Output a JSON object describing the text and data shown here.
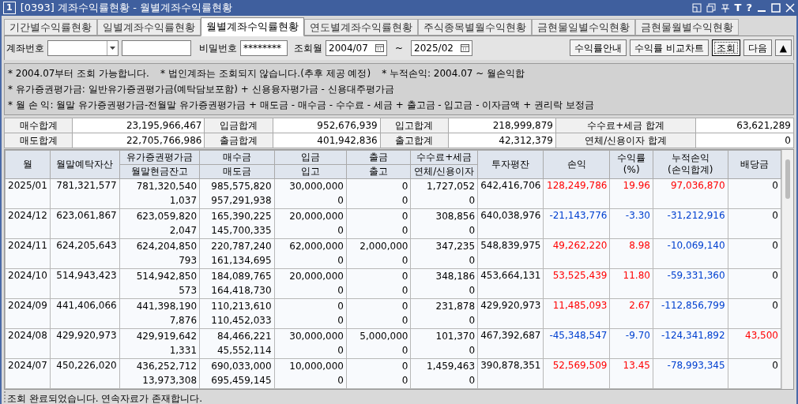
{
  "window": {
    "badge": "1",
    "title": "[0393] 계좌수익률현황 - 월별계좌수익률현황",
    "glyphs": [
      "T",
      "?"
    ]
  },
  "tabs": [
    {
      "label": "기간별수익률현황",
      "selected": false
    },
    {
      "label": "일별계좌수익률현황",
      "selected": false
    },
    {
      "label": "월별계좌수익률현황",
      "selected": true
    },
    {
      "label": "연도별계좌수익률현황",
      "selected": false
    },
    {
      "label": "주식종목별월수익현황",
      "selected": false
    },
    {
      "label": "금현물일별수익현황",
      "selected": false
    },
    {
      "label": "금현물월별수익현황",
      "selected": false
    }
  ],
  "form": {
    "account_label": "계좌번호",
    "password_label": "비밀번호",
    "password": "********",
    "period_label": "조회월",
    "from": "2004/07",
    "tilde": "~",
    "to": "2025/02"
  },
  "buttons": [
    {
      "label": "수익률안내",
      "focused": false
    },
    {
      "label": "수익률 비교차트",
      "focused": false
    },
    {
      "label": "조회",
      "focused": true
    },
    {
      "label": "다음",
      "focused": false
    },
    {
      "label": "▲",
      "focused": false
    }
  ],
  "notes": [
    [
      "* 2004.07부터 조회 가능합니다.",
      "* 법인계좌는 조회되지 않습니다.(추후 제공 예정)",
      "* 누적손익: 2004.07 ~ 월손익합"
    ],
    [
      "* 유가증권평가금: 일반유가증권평가금(예탁담보포함) + 신용융자평가금 - 신용대주평가금"
    ],
    [
      "* 월 손 익: 월말 유가증권평가금-전월말 유가증권평가금 + 매도금 - 매수금 - 수수료 - 세금 + 출고금 - 입고금 - 이자금액 + 권리락 보정금"
    ]
  ],
  "summary": [
    [
      {
        "label": "매수합계",
        "value": "23,195,966,467"
      },
      {
        "label": "입금합계",
        "value": "952,676,939"
      },
      {
        "label": "입고합계",
        "value": "218,999,879"
      },
      {
        "label": "수수료+세금 합계",
        "value": "63,621,289"
      }
    ],
    [
      {
        "label": "매도합계",
        "value": "22,705,766,986"
      },
      {
        "label": "출금합계",
        "value": "401,942,836"
      },
      {
        "label": "출고합계",
        "value": "42,312,379"
      },
      {
        "label": "연체/신용이자 합계",
        "value": "0"
      }
    ]
  ],
  "table": {
    "columns": [
      {
        "kind": "single",
        "lines": [
          "월"
        ]
      },
      {
        "kind": "single",
        "lines": [
          "월말예탁자산"
        ]
      },
      {
        "kind": "split",
        "top": "유가증권평가금",
        "bottom": "월말현금잔고"
      },
      {
        "kind": "split",
        "top": "매수금",
        "bottom": "매도금"
      },
      {
        "kind": "split",
        "top": "입금",
        "bottom": "입고"
      },
      {
        "kind": "split",
        "top": "출금",
        "bottom": "출고"
      },
      {
        "kind": "split",
        "top": "수수료+세금",
        "bottom": "연체/신용이자"
      },
      {
        "kind": "single",
        "lines": [
          "투자평잔"
        ]
      },
      {
        "kind": "single",
        "lines": [
          "손익"
        ]
      },
      {
        "kind": "single",
        "lines": [
          "수익률",
          "(%)"
        ]
      },
      {
        "kind": "single",
        "lines": [
          "누적손익",
          "(손익합계)"
        ]
      },
      {
        "kind": "single",
        "lines": [
          "배당금"
        ]
      }
    ],
    "rows": [
      {
        "month": "2025/01",
        "assets": "781,321,577",
        "sec": [
          "781,320,540",
          "1,037"
        ],
        "buy": [
          "985,575,820",
          "957,291,938"
        ],
        "dep": [
          "30,000,000",
          "0"
        ],
        "wd": [
          "0",
          "0"
        ],
        "fee": [
          "1,727,052",
          "0"
        ],
        "avg": "642,416,706",
        "pnl": {
          "value": "128,249,786",
          "color": "#ff0000"
        },
        "rate": {
          "value": "19.96",
          "color": "#ff0000"
        },
        "cum": {
          "value": "97,036,870",
          "color": "#ff0000"
        },
        "div": {
          "value": "0",
          "color": "#000000"
        }
      },
      {
        "month": "2024/12",
        "assets": "623,061,867",
        "sec": [
          "623,059,820",
          "2,047"
        ],
        "buy": [
          "165,390,225",
          "145,700,335"
        ],
        "dep": [
          "20,000,000",
          "0"
        ],
        "wd": [
          "0",
          "0"
        ],
        "fee": [
          "308,856",
          "0"
        ],
        "avg": "640,038,976",
        "pnl": {
          "value": "-21,143,776",
          "color": "#0040d0"
        },
        "rate": {
          "value": "-3.30",
          "color": "#0040d0"
        },
        "cum": {
          "value": "-31,212,916",
          "color": "#0040d0"
        },
        "div": {
          "value": "0",
          "color": "#000000"
        }
      },
      {
        "month": "2024/11",
        "assets": "624,205,643",
        "sec": [
          "624,204,850",
          "793"
        ],
        "buy": [
          "220,787,240",
          "161,134,695"
        ],
        "dep": [
          "62,000,000",
          "0"
        ],
        "wd": [
          "2,000,000",
          "0"
        ],
        "fee": [
          "347,235",
          "0"
        ],
        "avg": "548,839,975",
        "pnl": {
          "value": "49,262,220",
          "color": "#ff0000"
        },
        "rate": {
          "value": "8.98",
          "color": "#ff0000"
        },
        "cum": {
          "value": "-10,069,140",
          "color": "#0040d0"
        },
        "div": {
          "value": "0",
          "color": "#000000"
        }
      },
      {
        "month": "2024/10",
        "assets": "514,943,423",
        "sec": [
          "514,942,850",
          "573"
        ],
        "buy": [
          "184,089,765",
          "164,418,730"
        ],
        "dep": [
          "20,000,000",
          "0"
        ],
        "wd": [
          "0",
          "0"
        ],
        "fee": [
          "348,186",
          "0"
        ],
        "avg": "453,664,131",
        "pnl": {
          "value": "53,525,439",
          "color": "#ff0000"
        },
        "rate": {
          "value": "11.80",
          "color": "#ff0000"
        },
        "cum": {
          "value": "-59,331,360",
          "color": "#0040d0"
        },
        "div": {
          "value": "0",
          "color": "#000000"
        }
      },
      {
        "month": "2024/09",
        "assets": "441,406,066",
        "sec": [
          "441,398,190",
          "7,876"
        ],
        "buy": [
          "110,213,610",
          "110,452,033"
        ],
        "dep": [
          "0",
          "0"
        ],
        "wd": [
          "0",
          "0"
        ],
        "fee": [
          "231,878",
          "0"
        ],
        "avg": "429,920,973",
        "pnl": {
          "value": "11,485,093",
          "color": "#ff0000"
        },
        "rate": {
          "value": "2.67",
          "color": "#ff0000"
        },
        "cum": {
          "value": "-112,856,799",
          "color": "#0040d0"
        },
        "div": {
          "value": "0",
          "color": "#000000"
        }
      },
      {
        "month": "2024/08",
        "assets": "429,920,973",
        "sec": [
          "429,919,642",
          "1,331"
        ],
        "buy": [
          "84,466,221",
          "45,552,114"
        ],
        "dep": [
          "30,000,000",
          "0"
        ],
        "wd": [
          "5,000,000",
          "0"
        ],
        "fee": [
          "101,370",
          "0"
        ],
        "avg": "467,392,687",
        "pnl": {
          "value": "-45,348,547",
          "color": "#0040d0"
        },
        "rate": {
          "value": "-9.70",
          "color": "#0040d0"
        },
        "cum": {
          "value": "-124,341,892",
          "color": "#0040d0"
        },
        "div": {
          "value": "43,500",
          "color": "#ff0000"
        }
      },
      {
        "month": "2024/07",
        "assets": "450,226,020",
        "sec": [
          "436,252,712",
          "13,973,308"
        ],
        "buy": [
          "690,033,000",
          "695,459,145"
        ],
        "dep": [
          "10,000,000",
          "0"
        ],
        "wd": [
          "0",
          "0"
        ],
        "fee": [
          "1,459,463",
          "0"
        ],
        "avg": "390,878,351",
        "pnl": {
          "value": "52,569,509",
          "color": "#ff0000"
        },
        "rate": {
          "value": "13.45",
          "color": "#ff0000"
        },
        "cum": {
          "value": "-78,993,345",
          "color": "#0040d0"
        },
        "div": {
          "value": "0",
          "color": "#000000"
        }
      }
    ]
  },
  "status_bar": "조회 완료되었습니다. 연속자료가 존재합니다."
}
